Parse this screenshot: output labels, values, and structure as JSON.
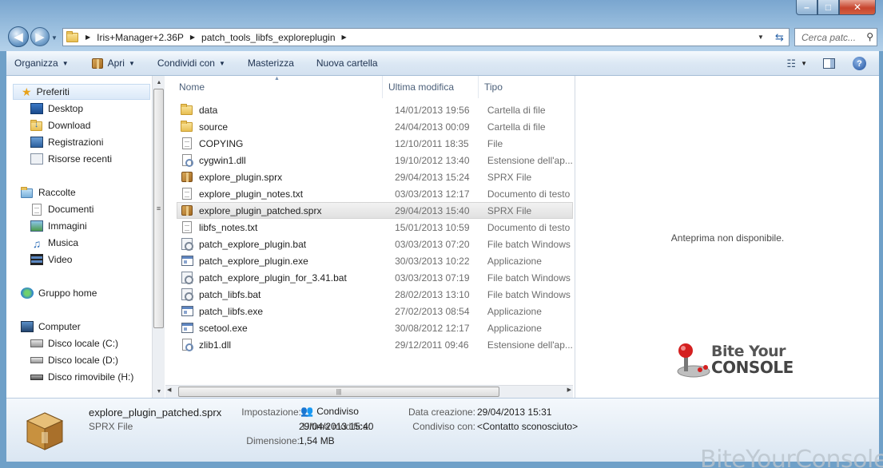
{
  "window": {
    "minimize": "–",
    "maximize": "□",
    "close": "✕"
  },
  "address": {
    "crumbs": [
      "Iris+Manager+2.36P",
      "patch_tools_libfs_exploreplugin"
    ],
    "search_placeholder": "Cerca patc..."
  },
  "toolbar": {
    "organize": "Organizza",
    "open": "Apri",
    "share": "Condividi con",
    "burn": "Masterizza",
    "new_folder": "Nuova cartella"
  },
  "nav": {
    "favorites": "Preferiti",
    "desktop": "Desktop",
    "download": "Download",
    "recordings": "Registrazioni",
    "recent": "Risorse recenti",
    "libraries": "Raccolte",
    "documents": "Documenti",
    "images": "Immagini",
    "music": "Musica",
    "video": "Video",
    "homegroup": "Gruppo home",
    "computer": "Computer",
    "disk_c": "Disco locale (C:)",
    "disk_d": "Disco locale (D:)",
    "disk_h": "Disco rimovibile (H:)"
  },
  "columns": {
    "name": "Nome",
    "modified": "Ultima modifica",
    "type": "Tipo"
  },
  "files": [
    {
      "icon": "folder",
      "name": "data",
      "date": "14/01/2013 19:56",
      "type": "Cartella di file"
    },
    {
      "icon": "folder",
      "name": "source",
      "date": "24/04/2013 00:09",
      "type": "Cartella di file"
    },
    {
      "icon": "doc",
      "name": "COPYING",
      "date": "12/10/2011 18:35",
      "type": "File"
    },
    {
      "icon": "dll",
      "name": "cygwin1.dll",
      "date": "19/10/2012 13:40",
      "type": "Estensione dell'ap..."
    },
    {
      "icon": "box",
      "name": "explore_plugin.sprx",
      "date": "29/04/2013 15:24",
      "type": "SPRX File"
    },
    {
      "icon": "doc",
      "name": "explore_plugin_notes.txt",
      "date": "03/03/2013 12:17",
      "type": "Documento di testo"
    },
    {
      "icon": "box",
      "name": "explore_plugin_patched.sprx",
      "date": "29/04/2013 15:40",
      "type": "SPRX File",
      "selected": true
    },
    {
      "icon": "doc",
      "name": "libfs_notes.txt",
      "date": "15/01/2013 10:59",
      "type": "Documento di testo"
    },
    {
      "icon": "bat",
      "name": "patch_explore_plugin.bat",
      "date": "03/03/2013 07:20",
      "type": "File batch Windows"
    },
    {
      "icon": "exe",
      "name": "patch_explore_plugin.exe",
      "date": "30/03/2013 10:22",
      "type": "Applicazione"
    },
    {
      "icon": "bat",
      "name": "patch_explore_plugin_for_3.41.bat",
      "date": "03/03/2013 07:19",
      "type": "File batch Windows"
    },
    {
      "icon": "bat",
      "name": "patch_libfs.bat",
      "date": "28/02/2013 13:10",
      "type": "File batch Windows"
    },
    {
      "icon": "exe",
      "name": "patch_libfs.exe",
      "date": "27/02/2013 08:54",
      "type": "Applicazione"
    },
    {
      "icon": "exe",
      "name": "scetool.exe",
      "date": "30/08/2012 12:17",
      "type": "Applicazione"
    },
    {
      "icon": "dll",
      "name": "zlib1.dll",
      "date": "29/12/2011 09:46",
      "type": "Estensione dell'ap..."
    }
  ],
  "preview": {
    "message": "Anteprima non disponibile.",
    "logo_line1": "Bite Your",
    "logo_line2": "CONSOLE"
  },
  "details": {
    "name": "explore_plugin_patched.sprx",
    "type": "SPRX File",
    "setting_label": "Impostazione:",
    "setting_value": "Condiviso",
    "modified_label": "Ultima modifica:",
    "modified_value": "29/04/2013 15:40",
    "size_label": "Dimensione:",
    "size_value": "1,54 MB",
    "created_label": "Data creazione:",
    "created_value": "29/04/2013 15:31",
    "shared_label": "Condiviso con:",
    "shared_value": "<Contatto sconosciuto>"
  },
  "watermark": "BiteYourConsole",
  "colors": {
    "accent": "#2a63a8",
    "frame": "#7aa6cf",
    "close": "#c7452e"
  }
}
